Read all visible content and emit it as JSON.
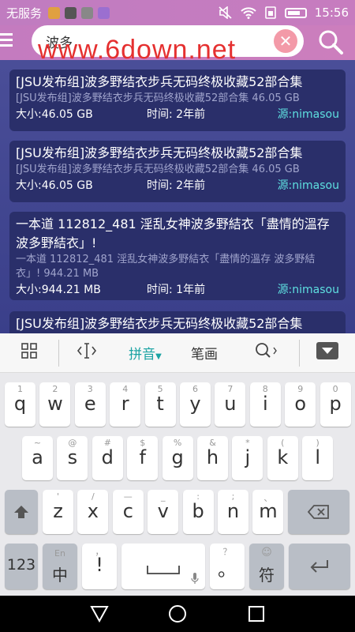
{
  "status_bar": {
    "carrier": "无服务",
    "time": "15:56"
  },
  "search": {
    "query": "波多",
    "clear_label": "✕"
  },
  "watermark": "www.6down.net",
  "results": [
    {
      "title": "[JSU发布组]波多野结衣步兵无码终极收藏52部合集",
      "subtitle": "[JSU发布组]波多野结衣步兵无码终极收藏52部合集 46.05 GB",
      "size": "大小:46.05 GB",
      "time": "时间: 2年前",
      "source": "源:nimasou"
    },
    {
      "title": "[JSU发布组]波多野结衣步兵无码终极收藏52部合集",
      "subtitle": "[JSU发布组]波多野结衣步兵无码终极收藏52部合集 46.05 GB",
      "size": "大小:46.05 GB",
      "time": "时间: 2年前",
      "source": "源:nimasou"
    },
    {
      "title": "一本道 112812_481 淫乱女神波多野結衣「盡情的溫存 波多野結衣」!",
      "subtitle": "一本道 112812_481 淫乱女神波多野結衣「盡情的溫存 波多野結衣」! 944.21 MB",
      "size": "大小:944.21 MB",
      "time": "时间: 1年前",
      "source": "源:nimasou"
    },
    {
      "title": "[JSU发布组]波多野结衣步兵无码终极收藏52部合集"
    }
  ],
  "keyboard": {
    "toolbar": {
      "pinyin": "拼音",
      "stroke": "笔画"
    },
    "row1": [
      {
        "sub": "1",
        "main": "q"
      },
      {
        "sub": "2",
        "main": "w"
      },
      {
        "sub": "3",
        "main": "e"
      },
      {
        "sub": "4",
        "main": "r"
      },
      {
        "sub": "5",
        "main": "t"
      },
      {
        "sub": "6",
        "main": "y"
      },
      {
        "sub": "7",
        "main": "u"
      },
      {
        "sub": "8",
        "main": "i"
      },
      {
        "sub": "9",
        "main": "o"
      },
      {
        "sub": "0",
        "main": "p"
      }
    ],
    "row2": [
      {
        "sub": "~",
        "main": "a"
      },
      {
        "sub": "@",
        "main": "s"
      },
      {
        "sub": "#",
        "main": "d"
      },
      {
        "sub": "$",
        "main": "f"
      },
      {
        "sub": "%",
        "main": "g"
      },
      {
        "sub": "&",
        "main": "h"
      },
      {
        "sub": "*",
        "main": "j"
      },
      {
        "sub": "(",
        "main": "k"
      },
      {
        "sub": ")",
        "main": "l"
      }
    ],
    "row3": [
      {
        "sub": "'",
        "main": "z"
      },
      {
        "sub": "/",
        "main": "x"
      },
      {
        "sub": "—",
        "main": "c"
      },
      {
        "sub": "_",
        "main": "v"
      },
      {
        "sub": ":",
        "main": "b"
      },
      {
        "sub": ";",
        "main": "n"
      },
      {
        "sub": "、",
        "main": "m"
      }
    ],
    "num_label": "123",
    "lang_top": "En",
    "lang_main": "中",
    "comma_sub": "，",
    "comma_main": "!",
    "period_sub": "？",
    "period_main": "。",
    "symbol_top": "☺",
    "symbol_main": "符"
  }
}
